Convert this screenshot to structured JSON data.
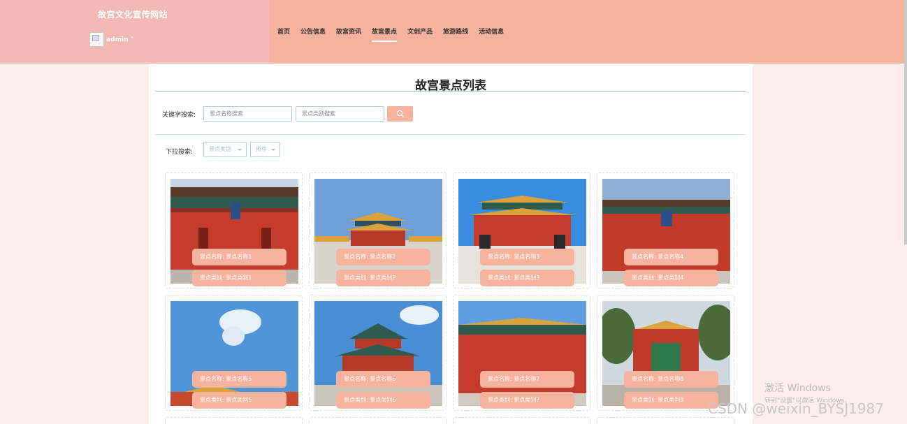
{
  "header": {
    "site_title": "故宫文化宣传网站",
    "username": "admin",
    "caret": "˅",
    "nav": [
      {
        "label": "首页"
      },
      {
        "label": "公告信息"
      },
      {
        "label": "故宫资讯"
      },
      {
        "label": "故宫景点"
      },
      {
        "label": "文创产品"
      },
      {
        "label": "旅游路线"
      },
      {
        "label": "活动信息"
      }
    ],
    "active_nav": "故宫景点"
  },
  "main": {
    "title": "故宫景点列表",
    "search": {
      "label": "关键字搜索:",
      "name_placeholder": "景点名称搜索",
      "type_placeholder": "景点类别搜索"
    },
    "dropdown": {
      "label": "下拉搜索:",
      "category": "景点类别",
      "sort": "排序"
    },
    "cards": [
      {
        "name": "景点名称: 景点名称1",
        "category": "景点类别: 景点类别1"
      },
      {
        "name": "景点名称: 景点名称2",
        "category": "景点类别: 景点类别2"
      },
      {
        "name": "景点名称: 景点名称3",
        "category": "景点类别: 景点类别3"
      },
      {
        "name": "景点名称: 景点名称4",
        "category": "景点类别: 景点类别4"
      },
      {
        "name": "景点名称: 景点名称5",
        "category": "景点类别: 景点类别5"
      },
      {
        "name": "景点名称: 景点名称6",
        "category": "景点类别: 景点类别6"
      },
      {
        "name": "景点名称: 景点名称7",
        "category": "景点类别: 景点类别7"
      },
      {
        "name": "景点名称: 景点名称8",
        "category": "景点类别: 景点类别8"
      }
    ]
  },
  "overlay": {
    "windows_line1": "激活 Windows",
    "windows_line2": "转到\"设置\"以激活 Windows。",
    "csdn": "CSDN @weixin_BYSJ1987"
  },
  "colors": {
    "accent": "#f5b29c",
    "brand_bg": "#f2b8b4",
    "page_bg": "#fdeeee",
    "border": "#a8d2d4"
  }
}
